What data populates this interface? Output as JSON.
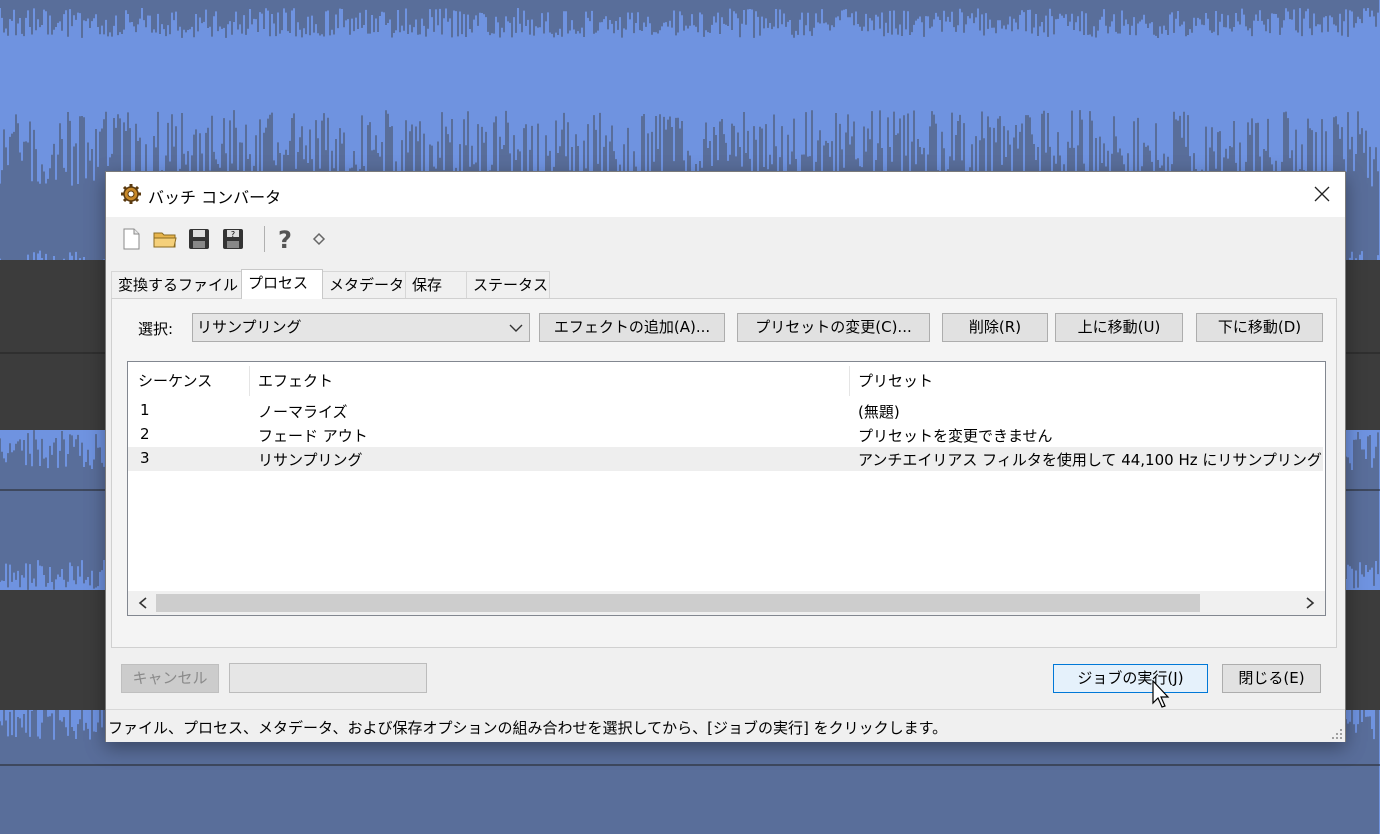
{
  "window": {
    "title": "バッチ コンバータ"
  },
  "toolbar": {
    "icons": [
      "new-file-icon",
      "open-folder-icon",
      "save-icon",
      "save-as-icon",
      "help-icon",
      "diamond-icon"
    ]
  },
  "tabs": [
    {
      "label": "変換するファイル",
      "active": false
    },
    {
      "label": "プロセス",
      "active": true
    },
    {
      "label": "メタデータ",
      "active": false
    },
    {
      "label": "保存",
      "active": false
    },
    {
      "label": "ステータス",
      "active": false
    }
  ],
  "process": {
    "select_label": "選択:",
    "select_value": "リサンプリング",
    "buttons": {
      "add_effect": "エフェクトの追加(A)...",
      "change_preset": "プリセットの変更(C)...",
      "delete": "削除(R)",
      "move_up": "上に移動(U)",
      "move_down": "下に移動(D)"
    },
    "columns": {
      "sequence": "シーケンス",
      "effect": "エフェクト",
      "preset": "プリセット"
    },
    "rows": [
      {
        "sequence": "1",
        "effect": "ノーマライズ",
        "preset": "(無題)",
        "selected": false
      },
      {
        "sequence": "2",
        "effect": "フェード アウト",
        "preset": "プリセットを変更できません",
        "selected": false
      },
      {
        "sequence": "3",
        "effect": "リサンプリング",
        "preset": "アンチエイリアス フィルタを使用して 44,100 Hz にリサンプリング",
        "selected": true
      }
    ]
  },
  "footer": {
    "cancel": "キャンセル",
    "run_job": "ジョブの実行(J)",
    "close": "閉じる(E)"
  },
  "status": "ファイル、プロセス、メタデータ、および保存オプションの組み合わせを選択してから、[ジョブの実行] をクリックします。",
  "colors": {
    "waveform_bg": "#6f93e0",
    "waveform_fg": "#3c3c3c",
    "accent": "#0078d7"
  }
}
